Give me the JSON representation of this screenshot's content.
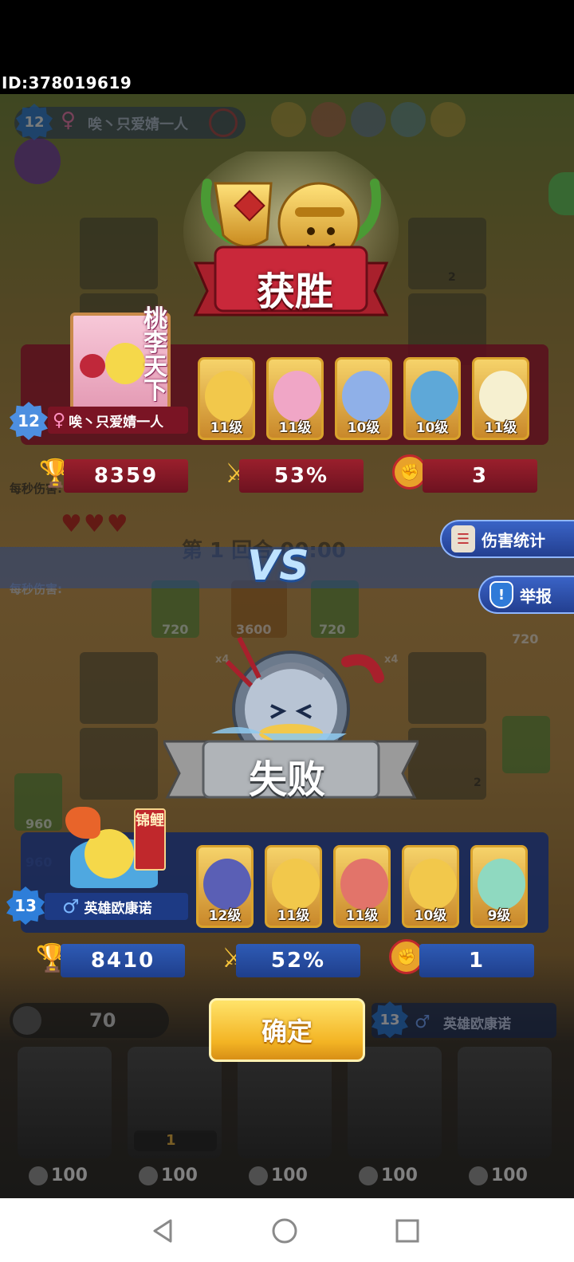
{
  "header": {
    "uid": "ID:378019619"
  },
  "background": {
    "opponent_level": "12",
    "opponent_name": "唉丶只爱婧一人",
    "opponent_gender": "♀",
    "dps_top": "每秒伤害:",
    "dps_bottom": "每秒伤害:",
    "round_text": "第 1 回合 00:00",
    "tile_values": [
      "720",
      "3600",
      "720",
      "720",
      "960",
      "960"
    ],
    "multipliers": [
      "x4",
      "x4"
    ],
    "badge_counts": [
      "2",
      "2"
    ],
    "my_level": "13",
    "my_name": "英雄欧康诺",
    "coins": "70",
    "hero_costs": [
      "100",
      "100",
      "100",
      "100",
      "100"
    ],
    "small_count": "1"
  },
  "winner": {
    "result_label": "获胜",
    "level": "12",
    "gender": "♀",
    "name": "唉丶只爱婧一人",
    "avatar_tag": "桃李天下",
    "heroes": [
      {
        "level_label": "11级",
        "color": "#f2c84b"
      },
      {
        "level_label": "11级",
        "color": "#f0a6c6"
      },
      {
        "level_label": "10级",
        "color": "#8fb0e8"
      },
      {
        "level_label": "10级",
        "color": "#5ea8d8"
      },
      {
        "level_label": "11级",
        "color": "#f6f0d0"
      }
    ],
    "trophies": "8359",
    "win_rate": "53%",
    "kills": "3",
    "panel_color": "#5a0f1e"
  },
  "vs_label": "VS",
  "loser": {
    "result_label": "失败",
    "level": "13",
    "gender": "♂",
    "name": "英雄欧康诺",
    "avatar_tag": "锦鲤",
    "heroes": [
      {
        "level_label": "12级",
        "color": "#5a5fb5"
      },
      {
        "level_label": "11级",
        "color": "#f2c84b"
      },
      {
        "level_label": "11级",
        "color": "#e2746a"
      },
      {
        "level_label": "10级",
        "color": "#f2c84b"
      },
      {
        "level_label": "9级",
        "color": "#8fd9c0"
      }
    ],
    "trophies": "8410",
    "win_rate": "52%",
    "kills": "1",
    "panel_color": "#142a5f"
  },
  "side_buttons": {
    "damage_stats": "伤害统计",
    "report": "举报"
  },
  "confirm_button": "确定",
  "icons": [
    "trophy-icon",
    "crossed-swords-icon",
    "fist-medal-icon",
    "shield-exclamation-icon",
    "damage-list-icon",
    "ban-icon"
  ]
}
